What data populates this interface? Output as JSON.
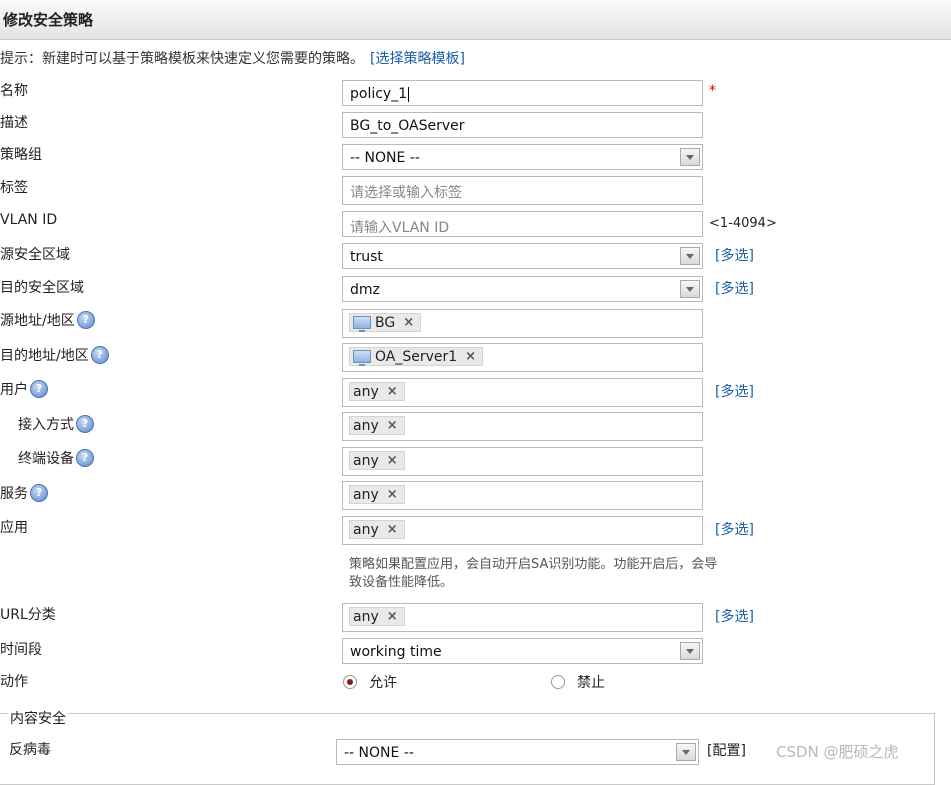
{
  "title": "修改安全策略",
  "hint": {
    "text": "提示：新建时可以基于策略模板来快速定义您需要的策略。",
    "link": "[选择策略模板]"
  },
  "labels": {
    "name": "名称",
    "desc": "描述",
    "group": "策略组",
    "tag": "标签",
    "vlan": "VLAN ID",
    "src_zone": "源安全区域",
    "dst_zone": "目的安全区域",
    "src_addr": "源地址/地区",
    "dst_addr": "目的地址/地区",
    "user": "用户",
    "access": "接入方式",
    "terminal": "终端设备",
    "service": "服务",
    "app": "应用",
    "url": "URL分类",
    "time": "时间段",
    "action": "动作"
  },
  "values": {
    "name": "policy_1",
    "desc": "BG_to_OAServer",
    "group": "-- NONE --",
    "src_zone": "trust",
    "dst_zone": "dmz",
    "src_addr": "BG",
    "dst_addr": "OA_Server1",
    "user": "any",
    "access": "any",
    "terminal": "any",
    "service": "any",
    "app": "any",
    "url": "any",
    "time": "working time"
  },
  "placeholders": {
    "tag": "请选择或输入标签",
    "vlan": "请输入VLAN ID"
  },
  "help_icon": "?",
  "tag_close": "×",
  "required_mark": "*",
  "vlan_range": "<1-4094>",
  "multi_select": "[多选]",
  "app_note": "策略如果配置应用，会自动开启SA识别功能。功能开启后，会导致设备性能降低。",
  "action": {
    "allow": "允许",
    "deny": "禁止",
    "selected": "allow"
  },
  "content_security": {
    "legend": "内容安全",
    "antivirus_label": "反病毒",
    "antivirus_value": "-- NONE --",
    "config": "[配置]"
  },
  "watermark": "CSDN @肥硕之虎",
  "colors": {
    "link": "#1a5fa8",
    "required": "#dd0000",
    "radio_selected": "#8a1b1b"
  },
  "icons": [
    "pc-icon",
    "help-icon",
    "dropdown-arrow-icon",
    "close-icon"
  ]
}
